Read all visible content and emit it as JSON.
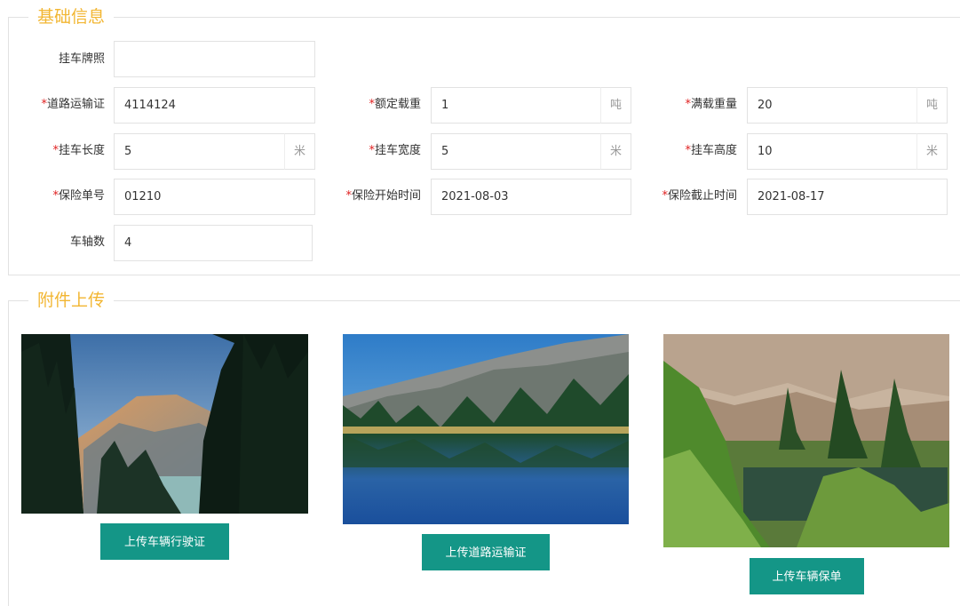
{
  "sections": {
    "basic": "基础信息",
    "attach": "附件上传"
  },
  "required_mark": "*",
  "fields": {
    "plate": {
      "label": "挂车牌照",
      "value": ""
    },
    "road_permit": {
      "label": "道路运输证",
      "value": "4114124"
    },
    "rated_load": {
      "label": "额定载重",
      "value": "1",
      "unit": "吨"
    },
    "full_weight": {
      "label": "满载重量",
      "value": "20",
      "unit": "吨"
    },
    "length": {
      "label": "挂车长度",
      "value": "5",
      "unit": "米"
    },
    "width": {
      "label": "挂车宽度",
      "value": "5",
      "unit": "米"
    },
    "height": {
      "label": "挂车高度",
      "value": "10",
      "unit": "米"
    },
    "policy_no": {
      "label": "保险单号",
      "value": "01210"
    },
    "ins_start": {
      "label": "保险开始时间",
      "value": "2021-08-03"
    },
    "ins_end": {
      "label": "保险截止时间",
      "value": "2021-08-17"
    },
    "axles": {
      "label": "车轴数",
      "value": "4"
    }
  },
  "uploads": {
    "license": "上传车辆行驶证",
    "road": "上传道路运输证",
    "policy": "上传车辆保单"
  },
  "colors": {
    "accent": "#f2b632",
    "button": "#149687",
    "required": "#e02020"
  }
}
